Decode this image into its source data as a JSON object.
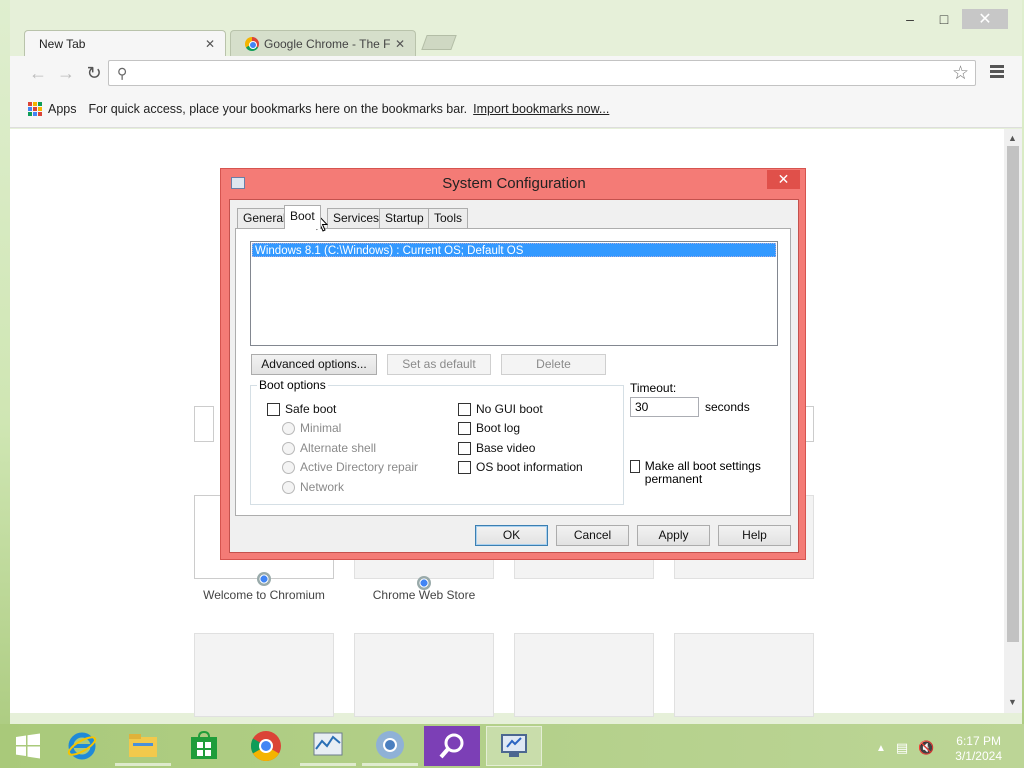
{
  "browser": {
    "tabs": [
      {
        "title": "New Tab",
        "active": true
      },
      {
        "title": "Google Chrome - The Fas",
        "active": false
      }
    ],
    "omnibox": {
      "value": "",
      "placeholder": ""
    },
    "bookmarks_bar": {
      "apps_label": "Apps",
      "message": "For quick access, place your bookmarks here on the bookmarks bar.",
      "import_link": "Import bookmarks now..."
    },
    "new_tab_page": {
      "tiles": [
        {
          "label": "Welcome to Chromium"
        },
        {
          "label": "Chrome Web Store"
        }
      ]
    }
  },
  "dialog": {
    "title": "System Configuration",
    "tabs": [
      "General",
      "Boot",
      "Services",
      "Startup",
      "Tools"
    ],
    "active_tab": "Boot",
    "os_list": [
      "Windows 8.1 (C:\\Windows) : Current OS; Default OS"
    ],
    "buttons": {
      "advanced": "Advanced options...",
      "set_default": "Set as default",
      "delete": "Delete"
    },
    "boot_options": {
      "group_label": "Boot options",
      "safe_boot": "Safe boot",
      "radios": [
        "Minimal",
        "Alternate shell",
        "Active Directory repair",
        "Network"
      ],
      "right_checks": [
        "No GUI boot",
        "Boot log",
        "Base video",
        "OS boot information"
      ]
    },
    "timeout": {
      "label": "Timeout:",
      "value": "30",
      "unit": "seconds"
    },
    "make_permanent": "Make all boot settings permanent",
    "footer": {
      "ok": "OK",
      "cancel": "Cancel",
      "apply": "Apply",
      "help": "Help"
    }
  },
  "taskbar": {
    "clock": {
      "time": "6:17 PM",
      "date": "3/1/2024"
    }
  }
}
